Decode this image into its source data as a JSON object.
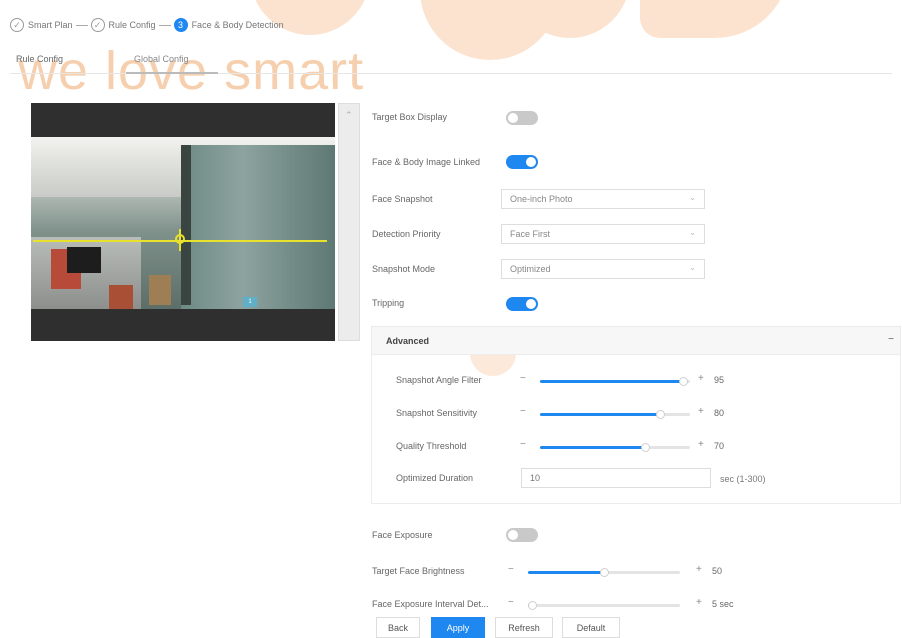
{
  "brand": {
    "watermark": "we love smart",
    "accent_color": "#1e87f0",
    "brand_color": "#f6cfae"
  },
  "stepper": {
    "steps": [
      {
        "number": "1",
        "label": "Smart Plan",
        "state": "done",
        "icon": "check-icon"
      },
      {
        "number": "2",
        "label": "Rule Config",
        "state": "done",
        "icon": "check-icon"
      },
      {
        "number": "3",
        "label": "Face & Body Detection",
        "state": "active"
      }
    ]
  },
  "tabs": [
    {
      "label": "Rule Config",
      "active": false
    },
    {
      "label": "Global Config",
      "active": true
    }
  ],
  "video": {
    "rule_tag": "1"
  },
  "settings": {
    "target_box_display": {
      "label": "Target Box Display",
      "on": false
    },
    "face_body_image_linked": {
      "label": "Face & Body Image Linked",
      "on": true
    },
    "face_snapshot": {
      "label": "Face Snapshot",
      "value": "One-inch Photo"
    },
    "detection_priority": {
      "label": "Detection Priority",
      "value": "Face First"
    },
    "snapshot_mode": {
      "label": "Snapshot Mode",
      "value": "Optimized"
    },
    "tripping": {
      "label": "Tripping",
      "on": true
    }
  },
  "advanced": {
    "title": "Advanced",
    "collapse_icon": "minus-icon",
    "snapshot_angle_filter": {
      "label": "Snapshot Angle Filter",
      "value": "95",
      "fraction": 0.95
    },
    "snapshot_sensitivity": {
      "label": "Snapshot Sensitivity",
      "value": "80",
      "fraction": 0.8
    },
    "quality_threshold": {
      "label": "Quality Threshold",
      "value": "70",
      "fraction": 0.7
    },
    "optimized_duration": {
      "label": "Optimized Duration",
      "value": "10",
      "unit": "sec (1-300)"
    }
  },
  "exposure": {
    "face_exposure": {
      "label": "Face Exposure",
      "on": false
    },
    "target_face_brightness": {
      "label": "Target Face Brightness",
      "value": "50",
      "fraction": 0.5
    },
    "face_exposure_interval": {
      "label": "Face Exposure Interval Det...",
      "value": "5 sec",
      "fraction": 0.02
    }
  },
  "buttons": {
    "back": "Back",
    "apply": "Apply",
    "refresh": "Refresh",
    "default": "Default"
  }
}
